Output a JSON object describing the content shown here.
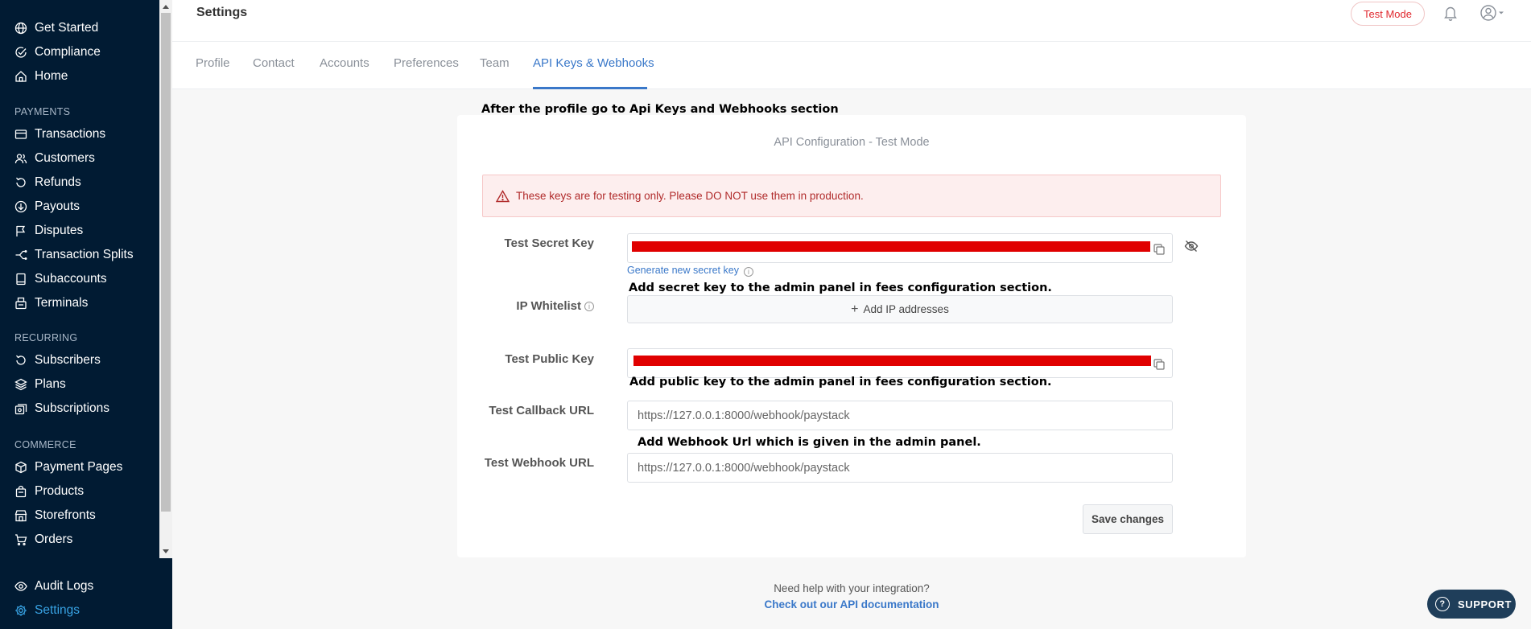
{
  "sidebar": {
    "top_items": [
      {
        "label": "Get Started",
        "icon": "globe-icon"
      },
      {
        "label": "Compliance",
        "icon": "check-circle-icon"
      },
      {
        "label": "Home",
        "icon": "home-icon"
      }
    ],
    "sections": [
      {
        "title": "PAYMENTS",
        "items": [
          {
            "label": "Transactions",
            "icon": "card-icon"
          },
          {
            "label": "Customers",
            "icon": "users-icon"
          },
          {
            "label": "Refunds",
            "icon": "refund-icon"
          },
          {
            "label": "Payouts",
            "icon": "payout-icon"
          },
          {
            "label": "Disputes",
            "icon": "flag-icon"
          },
          {
            "label": "Transaction Splits",
            "icon": "split-icon"
          },
          {
            "label": "Subaccounts",
            "icon": "book-icon"
          },
          {
            "label": "Terminals",
            "icon": "terminal-icon"
          }
        ]
      },
      {
        "title": "RECURRING",
        "items": [
          {
            "label": "Subscribers",
            "icon": "refresh-icon"
          },
          {
            "label": "Plans",
            "icon": "layers-icon"
          },
          {
            "label": "Subscriptions",
            "icon": "subscriptions-icon"
          }
        ]
      },
      {
        "title": "COMMERCE",
        "items": [
          {
            "label": "Payment Pages",
            "icon": "box-icon"
          },
          {
            "label": "Products",
            "icon": "bag-icon"
          },
          {
            "label": "Storefronts",
            "icon": "store-icon"
          },
          {
            "label": "Orders",
            "icon": "cart-icon"
          }
        ]
      }
    ],
    "bottom_items": [
      {
        "label": "Audit Logs",
        "icon": "eye-icon"
      },
      {
        "label": "Settings",
        "icon": "gear-icon"
      }
    ]
  },
  "header": {
    "title": "Settings",
    "test_mode": "Test Mode"
  },
  "tabs": [
    {
      "label": "Profile"
    },
    {
      "label": "Contact"
    },
    {
      "label": "Accounts"
    },
    {
      "label": "Preferences"
    },
    {
      "label": "Team"
    },
    {
      "label": "API Keys & Webhooks",
      "active": true
    }
  ],
  "annotations": {
    "top": "After the profile go to Api Keys and Webhooks section",
    "secret": "Add secret key to the admin panel in fees configuration section.",
    "public": "Add public key to the admin panel in fees configuration section.",
    "webhook": "Add Webhook Url which is given in the admin panel."
  },
  "api_config": {
    "title": "API Configuration - Test Mode",
    "warning": "These keys are for testing only. Please DO NOT use them in production.",
    "secret_key_label": "Test Secret Key",
    "generate_link": "Generate new secret key",
    "ip_whitelist_label": "IP Whitelist",
    "add_ip_label": "Add IP addresses",
    "public_key_label": "Test Public Key",
    "callback_label": "Test Callback URL",
    "callback_value": "https://127.0.0.1:8000/webhook/paystack",
    "webhook_label": "Test Webhook URL",
    "webhook_value": "https://127.0.0.1:8000/webhook/paystack",
    "save_label": "Save changes"
  },
  "help": {
    "text": "Need help with your integration?",
    "link": "Check out our API documentation"
  },
  "support_label": "SUPPORT",
  "colors": {
    "sidebar_bg": "#011b33",
    "accent_blue": "#3a78c9",
    "alert_red": "#b02a2a",
    "redaction": "#e00000"
  }
}
